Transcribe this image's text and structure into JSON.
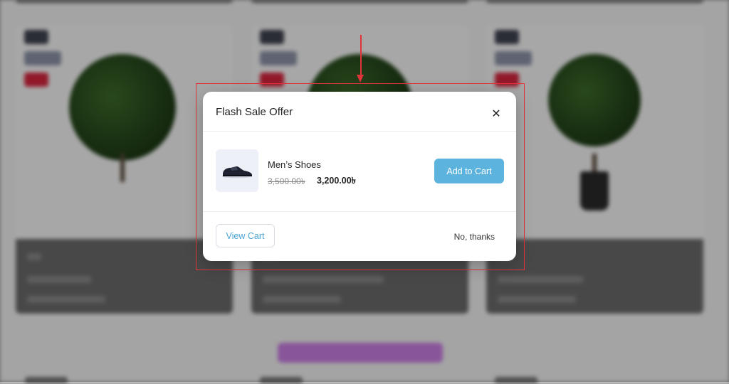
{
  "modal": {
    "title": "Flash Sale Offer",
    "close_icon": "close-icon",
    "product": {
      "name": "Men’s Shoes",
      "old_price": "3,500.00৳",
      "new_price": "3,200.00৳",
      "image_icon": "shoe-icon"
    },
    "add_to_cart_label": "Add to Cart",
    "view_cart_label": "View Cart",
    "no_thanks_label": "No, thanks"
  },
  "colors": {
    "accent": "#5cb3de",
    "annotation": "#e0343b",
    "category_heading": "#c268e0"
  }
}
